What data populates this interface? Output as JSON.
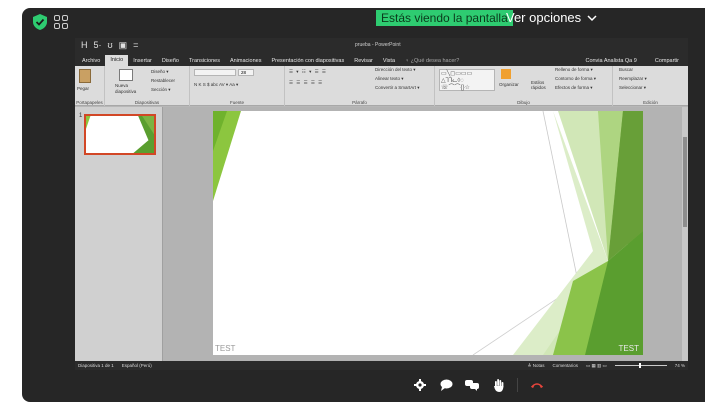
{
  "share_banner": {
    "status_text": "Estás viendo la pantalla",
    "view_options_label": "Ver opciones"
  },
  "colors": {
    "accent_green": "#2ecc71",
    "hangup_red": "#e8453c",
    "ppt_active_tab_border": "#d24726"
  },
  "icons": {
    "security": "shield-check-icon",
    "layout": "grid-icon",
    "settings": "gear-icon",
    "chat": "chat-icon",
    "reactions": "chat-bubbles-icon",
    "raise_hand": "hand-icon",
    "hangup": "phone-hangup-icon"
  },
  "ppt": {
    "window_title": "prueba - PowerPoint",
    "quick_access": [
      "H",
      "5·",
      "ʊ",
      "▣",
      "="
    ],
    "tabs": [
      {
        "label": "Archivo",
        "active": false
      },
      {
        "label": "Inicio",
        "active": true
      },
      {
        "label": "Insertar",
        "active": false
      },
      {
        "label": "Diseño",
        "active": false
      },
      {
        "label": "Transiciones",
        "active": false
      },
      {
        "label": "Animaciones",
        "active": false
      },
      {
        "label": "Presentación con diapositivas",
        "active": false
      },
      {
        "label": "Revisar",
        "active": false
      },
      {
        "label": "Vista",
        "active": false
      }
    ],
    "tell_me": "♀ ¿Qué desea hacer?",
    "account": "Convia Analista Qa 9",
    "share": "Compartir",
    "ribbon": {
      "clipboard": {
        "paste": "Pegar",
        "label": "Portapapeles"
      },
      "slides": {
        "new_slide": "Nueva diapositiva",
        "design": "Diseño ▾",
        "reset": "Restablecer",
        "section": "Sección ▾",
        "label": "Diapositivas"
      },
      "font": {
        "size": "28",
        "label": "Fuente",
        "style_row": "N  K  S  $  abc  AV ▾  Aa ▾"
      },
      "paragraph": {
        "label": "Párrafo",
        "text_direction": "Dirección del texto ▾",
        "align_text": "Alinear texto ▾",
        "smartart": "Convertir a SmartArt ▾"
      },
      "drawing": {
        "label": "Dibujo",
        "arrange": "Organizar",
        "quick_styles": "Estilos rápidos",
        "fill": "Relleno de forma ▾",
        "outline": "Contorno de forma ▾",
        "effects": "Efectos de forma ▾"
      },
      "editing": {
        "label": "Edición",
        "find": "Buscar",
        "replace": "Reemplazar ▾",
        "select": "Seleccionar ▾"
      }
    },
    "thumbnail_number": "1",
    "slide_caption": "TEST",
    "status": {
      "slide_count": "Diapositiva 1 de 1",
      "language": "Español (Perú)",
      "notes": "≜ Notas",
      "comments": "Comentarios",
      "zoom": "74 %"
    }
  }
}
